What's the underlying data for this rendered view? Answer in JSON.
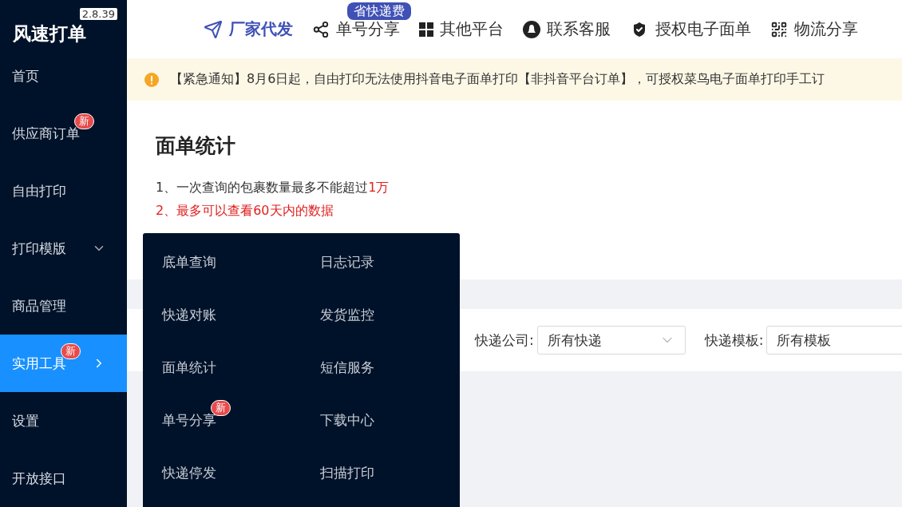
{
  "app": {
    "name": "风速打单",
    "version": "2.8.39"
  },
  "top_nav": [
    {
      "label": "厂家代发",
      "selected": true
    },
    {
      "label": "单号分享",
      "selected": false,
      "badge": "省快递费"
    },
    {
      "label": "其他平台",
      "selected": false
    },
    {
      "label": "联系客服",
      "selected": false
    },
    {
      "label": "授权电子面单",
      "selected": false
    },
    {
      "label": "物流分享",
      "selected": false
    }
  ],
  "notice": "【紧急通知】8月6日起，自由打印无法使用抖音电子面单打印【非抖音平台订单】，可授权菜鸟电子面单打印手工订",
  "sidebar": {
    "items": [
      {
        "label": "首页",
        "selected": false,
        "kind": "link"
      },
      {
        "label": "供应商订单",
        "selected": false,
        "badge": "新",
        "kind": "link"
      },
      {
        "label": "自由打印",
        "selected": false,
        "kind": "link"
      },
      {
        "label": "打印模版",
        "selected": false,
        "kind": "group"
      },
      {
        "label": "商品管理",
        "selected": false,
        "kind": "link"
      },
      {
        "label": "实用工具",
        "selected": true,
        "badge": "新",
        "kind": "popout"
      },
      {
        "label": "设置",
        "selected": false,
        "kind": "link"
      },
      {
        "label": "开放接口",
        "selected": false,
        "kind": "link"
      }
    ]
  },
  "page": {
    "title": "面单统计",
    "notes": [
      {
        "text": "1、一次查询的包裹数量最多不能超过",
        "highlight": "1万",
        "kind": "normal"
      },
      {
        "text": "2、最多可以查看60天内的数据",
        "kind": "warning"
      }
    ]
  },
  "filters": [
    {
      "label": "快递公司:",
      "value": "所有快递",
      "dropdown": true
    },
    {
      "label": "快递模板:",
      "value": "所有模板",
      "dropdown": false
    }
  ],
  "tools_menu": [
    {
      "label": "底单查询"
    },
    {
      "label": "日志记录"
    },
    {
      "label": "快递对账"
    },
    {
      "label": "发货监控"
    },
    {
      "label": "面单统计"
    },
    {
      "label": "短信服务"
    },
    {
      "label": "单号分享",
      "badge": "新"
    },
    {
      "label": "下载中心"
    },
    {
      "label": "快递停发"
    },
    {
      "label": "扫描打印"
    }
  ]
}
